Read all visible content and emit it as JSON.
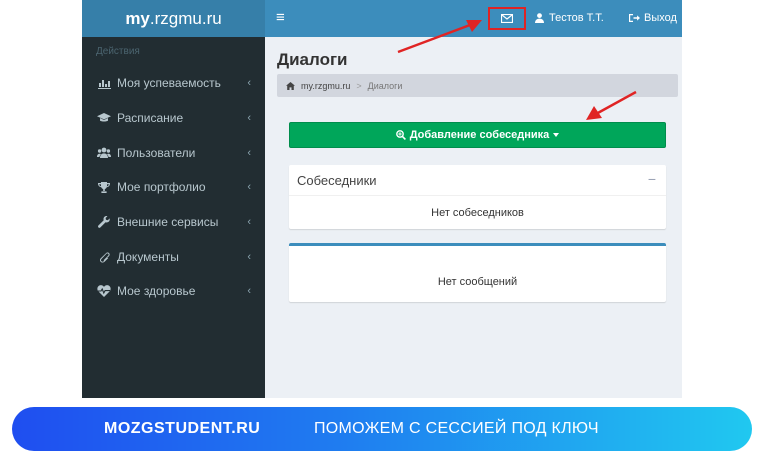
{
  "logo": {
    "bold": "my",
    "rest": ".rzgmu.ru"
  },
  "sidebar": {
    "section": "Действия",
    "items": [
      {
        "label": "Моя успеваемость",
        "icon": "chart-icon"
      },
      {
        "label": "Расписание",
        "icon": "graduation-cap-icon"
      },
      {
        "label": "Пользователи",
        "icon": "users-icon"
      },
      {
        "label": "Мое портфолио",
        "icon": "trophy-icon"
      },
      {
        "label": "Внешние сервисы",
        "icon": "wrench-icon"
      },
      {
        "label": "Документы",
        "icon": "paperclip-icon"
      },
      {
        "label": "Мое здоровье",
        "icon": "heartbeat-icon"
      }
    ]
  },
  "navbar": {
    "toggle": "≡",
    "user": "Тестов Т.Т.",
    "logout": "Выход"
  },
  "main": {
    "title": "Диалоги",
    "breadcrumb": {
      "home": "my.rzgmu.ru",
      "sep": ">",
      "current": "Диалоги"
    },
    "add_button": "Добавление собеседника",
    "contacts_box": {
      "title": "Собеседники",
      "collapse": "−",
      "empty": "Нет собеседников"
    },
    "messages_box": {
      "empty": "Нет сообщений"
    }
  },
  "banner": {
    "brand": "MOZGSTUDENT.RU",
    "slogan": "ПОМОЖЕМ С СЕССИЕЙ ПОД КЛЮЧ"
  },
  "colors": {
    "header_blue": "#3c8dbc",
    "logo_blue": "#367fa9",
    "sidebar_dark": "#222d32",
    "success_green": "#00a65a",
    "annotation_red": "#e02424"
  }
}
